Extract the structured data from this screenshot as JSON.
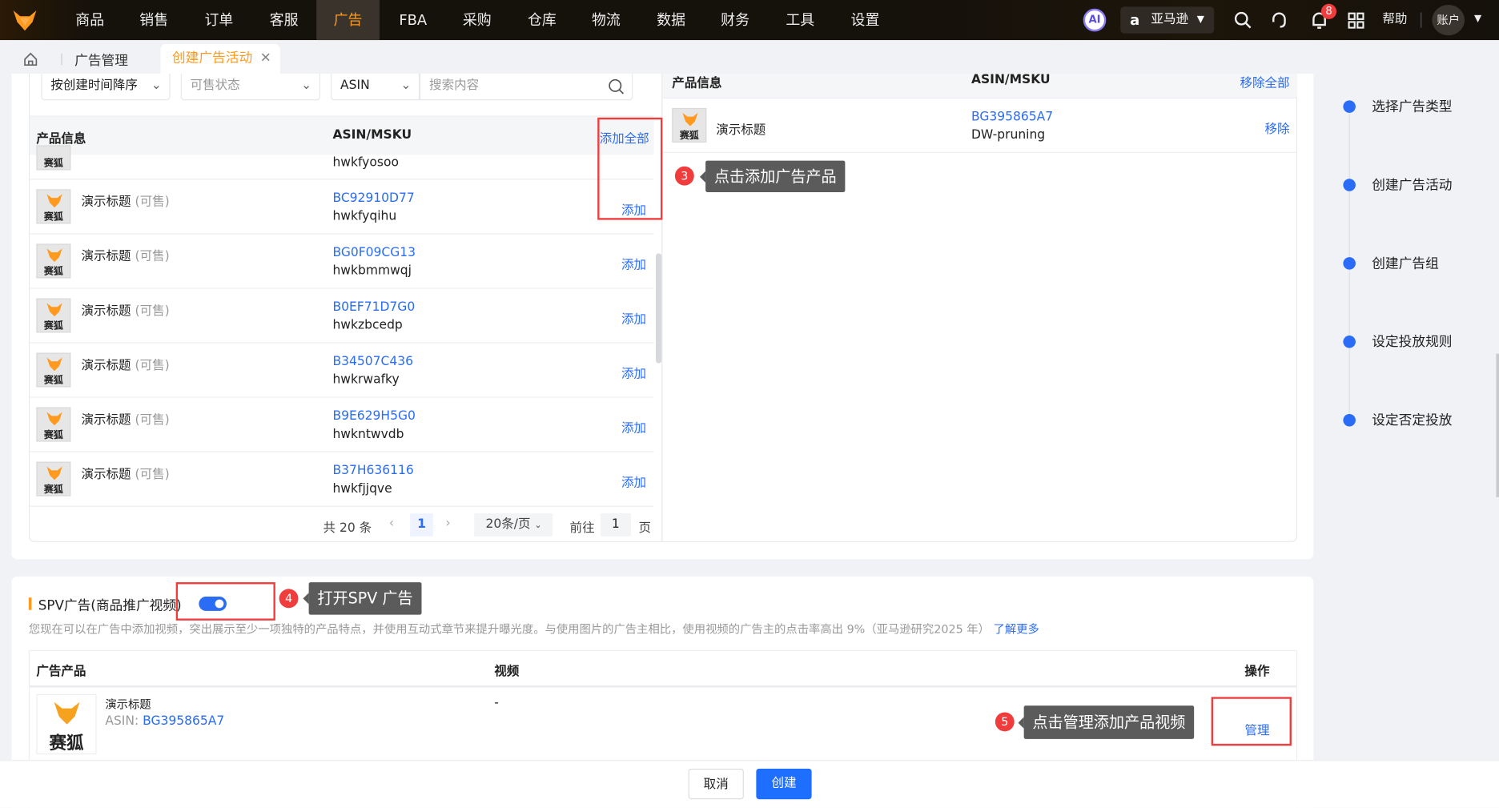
{
  "nav": {
    "items": [
      "商品",
      "销售",
      "订单",
      "客服",
      "广告",
      "FBA",
      "采购",
      "仓库",
      "物流",
      "数据",
      "财务",
      "工具",
      "设置"
    ],
    "active": "广告",
    "ai": "AI",
    "store": "亚马逊",
    "notifications": "8",
    "help": "帮助",
    "account": "账户"
  },
  "tabs": {
    "manage": "广告管理",
    "active": "创建广告活动"
  },
  "filters": {
    "sort": "按创建时间降序",
    "status_placeholder": "可售状态",
    "field": "ASIN",
    "search_placeholder": "搜索内容"
  },
  "left_table": {
    "col_product": "产品信息",
    "col_asin": "ASIN/MSKU",
    "add_all": "添加全部",
    "partial_msku": "hwkfyosoo",
    "partial_action": "添加",
    "rows": [
      {
        "title": "演示标题",
        "status": "(可售)",
        "asin": "BC92910D77",
        "msku": "hwkfyqihu",
        "action": "添加"
      },
      {
        "title": "演示标题",
        "status": "(可售)",
        "asin": "BG0F09CG13",
        "msku": "hwkbmmwqj",
        "action": "添加"
      },
      {
        "title": "演示标题",
        "status": "(可售)",
        "asin": "B0EF71D7G0",
        "msku": "hwkzbcedp",
        "action": "添加"
      },
      {
        "title": "演示标题",
        "status": "(可售)",
        "asin": "B34507C436",
        "msku": "hwkrwafky",
        "action": "添加"
      },
      {
        "title": "演示标题",
        "status": "(可售)",
        "asin": "B9E629H5G0",
        "msku": "hwkntwvdb",
        "action": "添加"
      },
      {
        "title": "演示标题",
        "status": "(可售)",
        "asin": "B37H636116",
        "msku": "hwkfjjqve",
        "action": "添加"
      }
    ],
    "thumb_text": "赛狐"
  },
  "pagination": {
    "total": "共 20 条",
    "page": "1",
    "page_size": "20条/页",
    "goto": "前往",
    "goto_value": "1",
    "page_unit": "页"
  },
  "right_table": {
    "col_product": "产品信息",
    "col_asin": "ASIN/MSKU",
    "remove_all": "移除全部",
    "rows": [
      {
        "title": "演示标题",
        "asin": "BG395865A7",
        "msku": "DW-pruning",
        "action": "移除"
      }
    ]
  },
  "annotations": {
    "a3": {
      "num": "3",
      "text": "点击添加广告产品"
    },
    "a4": {
      "num": "4",
      "text": "打开SPV 广告"
    },
    "a5": {
      "num": "5",
      "text": "点击管理添加产品视频"
    }
  },
  "steps": [
    "选择广告类型",
    "创建广告活动",
    "创建广告组",
    "设定投放规则",
    "设定否定投放"
  ],
  "spv": {
    "title": "SPV广告(商品推广视频)",
    "enabled": true,
    "description": "您现在可以在广告中添加视频，突出展示至少一项独特的产品特点，并使用互动式章节来提升曝光度。与使用图片的广告主相比，使用视频的广告主的点击率高出 9%（亚马逊研究2025 年）",
    "learn_more": "了解更多",
    "col_product": "广告产品",
    "col_video": "视频",
    "col_action": "操作",
    "row": {
      "title": "演示标题",
      "asin_label": "ASIN: ",
      "asin": "BG395865A7",
      "video": "-",
      "action": "管理",
      "thumb_text": "赛狐"
    }
  },
  "footer": {
    "cancel": "取消",
    "create": "创建"
  },
  "colors": {
    "accent": "#2a6cf6",
    "brand": "#ff9a1f",
    "annotation": "#f03c3c"
  }
}
